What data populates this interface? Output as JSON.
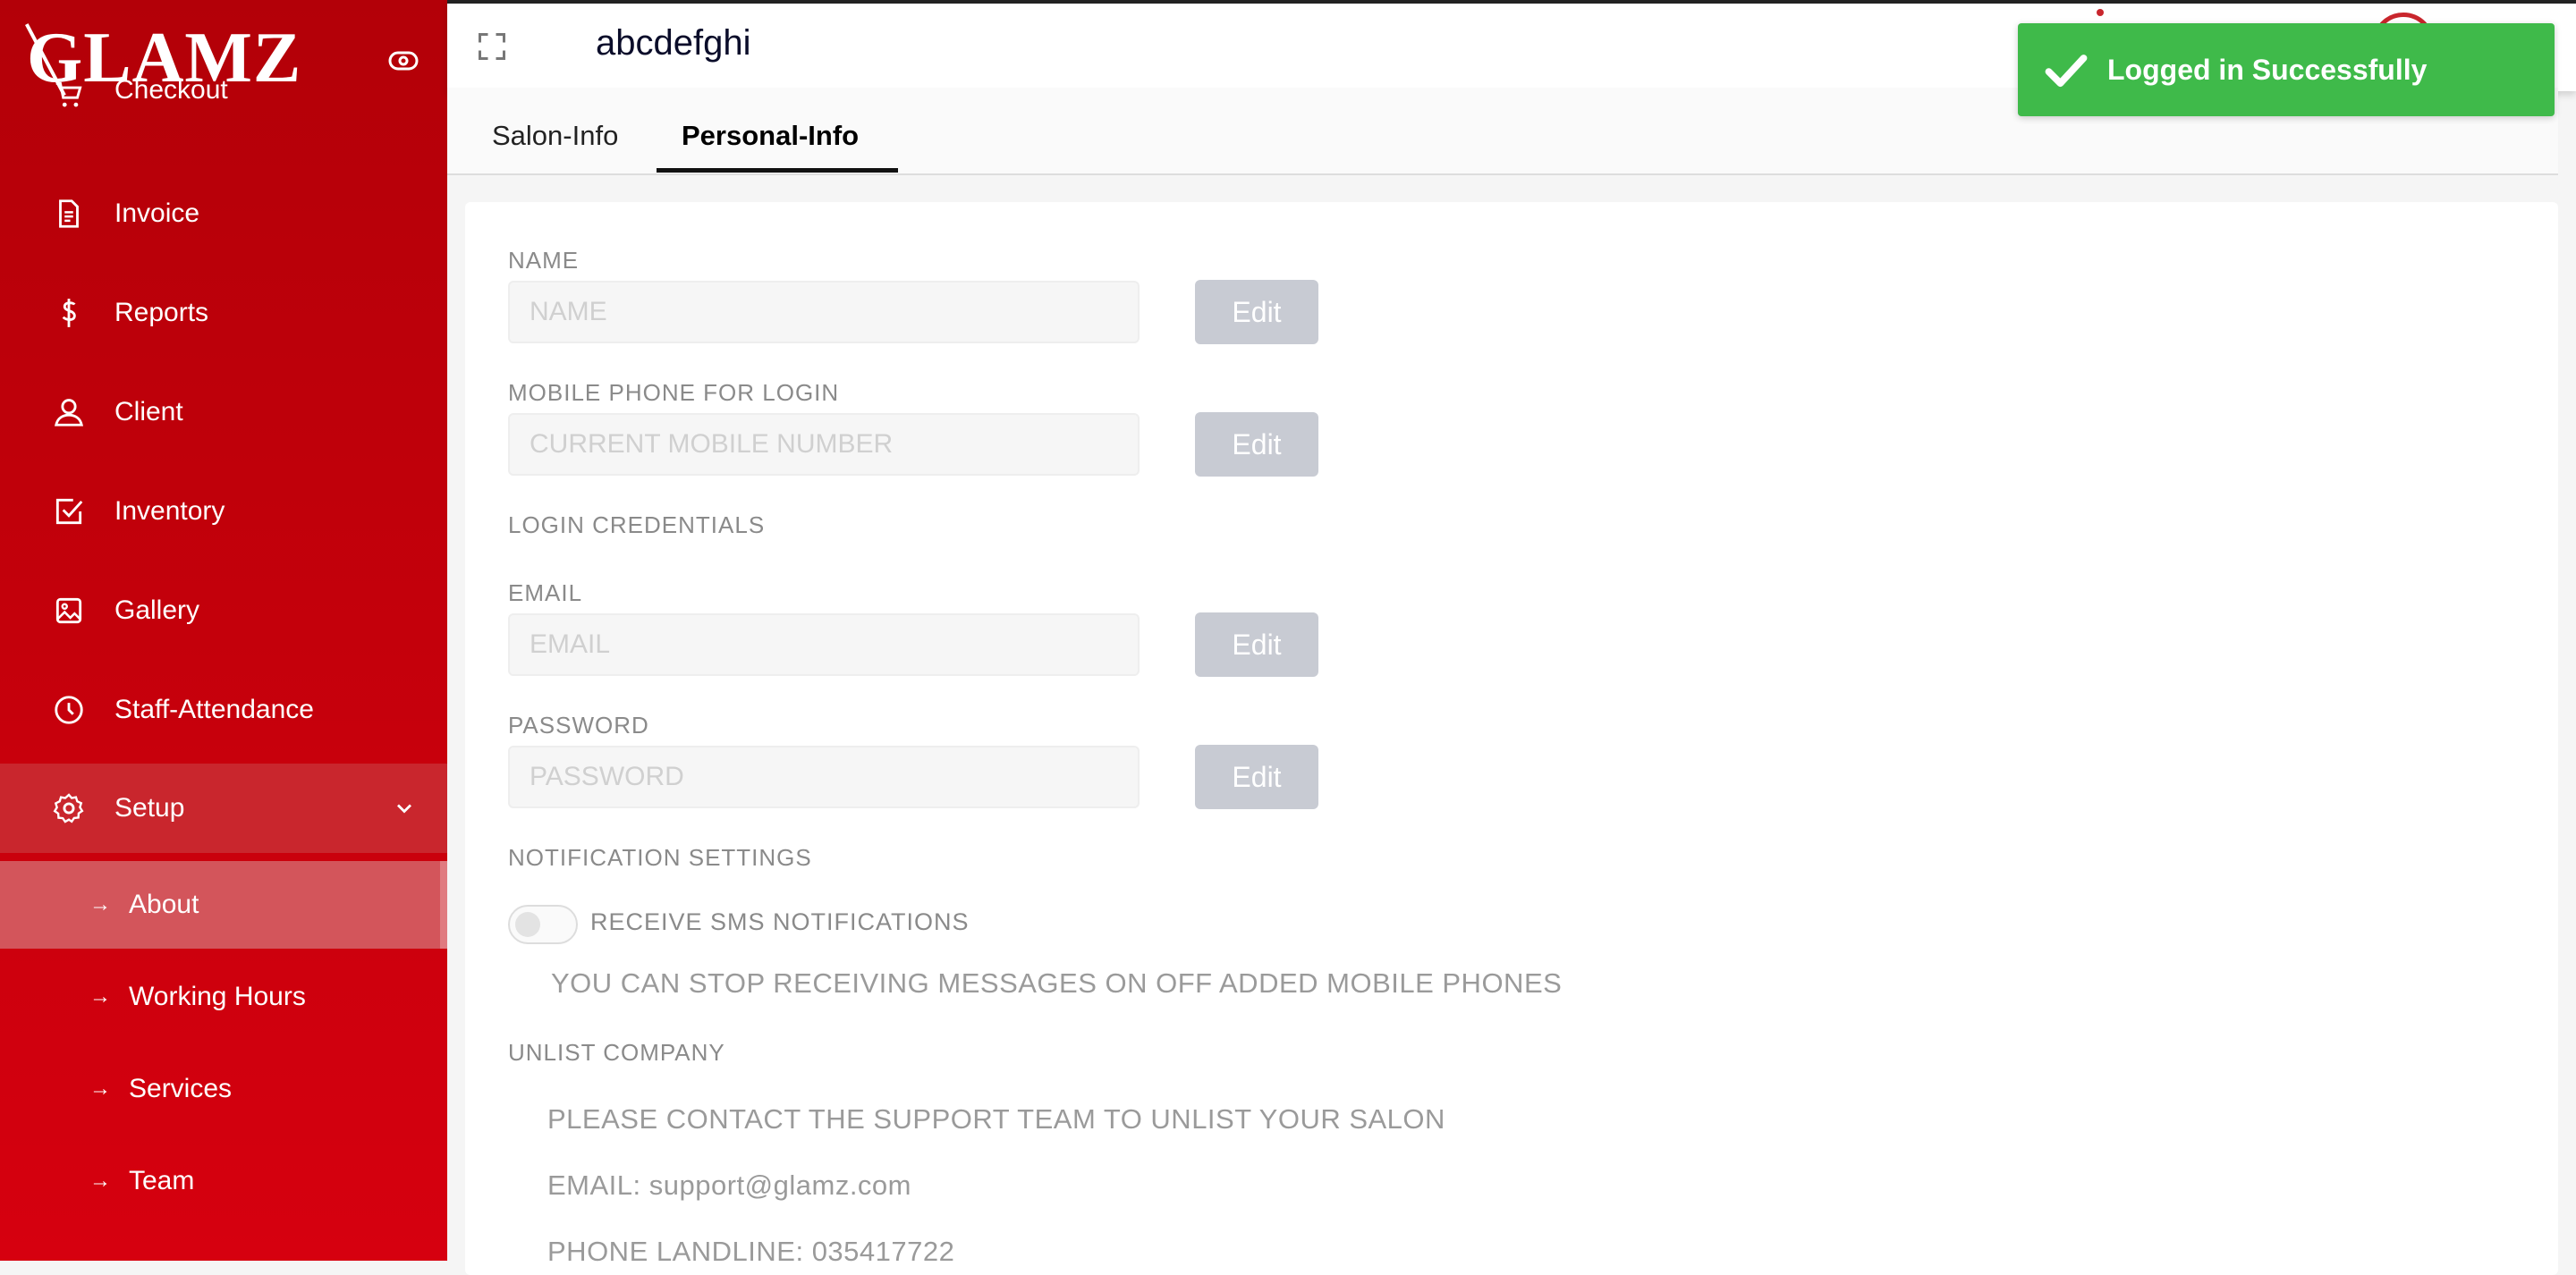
{
  "brand": {
    "logo_text": "GLAMZ"
  },
  "sidebar": {
    "items": [
      {
        "label": "Checkout",
        "icon": "cart-icon"
      },
      {
        "label": "Invoice",
        "icon": "document-icon"
      },
      {
        "label": "Reports",
        "icon": "dollar-icon"
      },
      {
        "label": "Client",
        "icon": "user-icon"
      },
      {
        "label": "Inventory",
        "icon": "checkbox-icon"
      },
      {
        "label": "Gallery",
        "icon": "image-icon"
      },
      {
        "label": "Staff-Attendance",
        "icon": "clock-icon"
      },
      {
        "label": "Setup",
        "icon": "gear-icon"
      }
    ],
    "setup_sub": [
      {
        "label": "About",
        "active": true
      },
      {
        "label": "Working Hours"
      },
      {
        "label": "Services"
      },
      {
        "label": "Team"
      }
    ],
    "sub_arrow": "→"
  },
  "header": {
    "title": "abcdefghi"
  },
  "tabs": [
    {
      "label": "Salon-Info"
    },
    {
      "label": "Personal-Info",
      "active": true
    }
  ],
  "form": {
    "name_label": "NAME",
    "name_placeholder": "NAME",
    "mobile_label": "MOBILE PHONE FOR LOGIN",
    "mobile_placeholder": "CURRENT MOBILE NUMBER",
    "login_credentials_heading": "LOGIN CREDENTIALS",
    "email_label": "EMAIL",
    "email_placeholder": "EMAIL",
    "password_label": "PASSWORD",
    "password_placeholder": "PASSWORD",
    "edit_label": "Edit",
    "notification_heading": "NOTIFICATION SETTINGS",
    "sms_label": "RECEIVE SMS NOTIFICATIONS",
    "sms_enabled": false,
    "sms_info": "YOU CAN STOP RECEIVING MESSAGES ON OFF ADDED MOBILE PHONES",
    "unlist_heading": "UNLIST COMPANY",
    "unlist_info": "PLEASE CONTACT THE SUPPORT TEAM TO UNLIST YOUR SALON",
    "support_email": "EMAIL: support@glamz.com",
    "support_phone": "PHONE LANDLINE: 035417722"
  },
  "toast": {
    "message": "Logged in Successfully",
    "icon": "check-icon"
  },
  "colors": {
    "sidebar": "#c4000b",
    "toast": "#3fba4a",
    "edit_button": "#c8cbd3"
  }
}
